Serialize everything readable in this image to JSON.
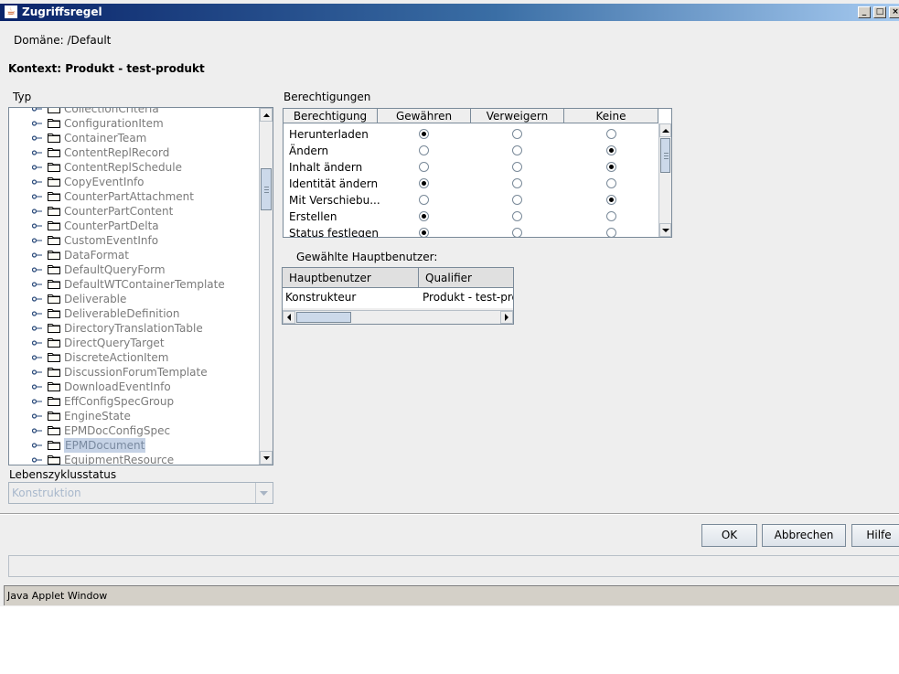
{
  "window": {
    "title": "Zugriffsregel",
    "icon": "java-coffee-icon",
    "controls": {
      "minimize": "_",
      "maximize": "□",
      "close": "×"
    }
  },
  "domain": {
    "label": "Domäne:",
    "value": "/Default"
  },
  "context": {
    "text": "Kontext: Produkt - test-produkt"
  },
  "type_panel": {
    "label": "Typ",
    "partial_top_item": "CollectionCriteria",
    "items": [
      "ConfigurationItem",
      "ContainerTeam",
      "ContentReplRecord",
      "ContentReplSchedule",
      "CopyEventInfo",
      "CounterPartAttachment",
      "CounterPartContent",
      "CounterPartDelta",
      "CustomEventInfo",
      "DataFormat",
      "DefaultQueryForm",
      "DefaultWTContainerTemplate",
      "Deliverable",
      "DeliverableDefinition",
      "DirectoryTranslationTable",
      "DirectQueryTarget",
      "DiscreteActionItem",
      "DiscussionForumTemplate",
      "DownloadEventInfo",
      "EffConfigSpecGroup",
      "EngineState",
      "EPMDocConfigSpec",
      "EPMDocument",
      "EquipmentResource"
    ],
    "selected": "EPMDocument"
  },
  "lifecycle": {
    "label": "Lebenszyklusstatus",
    "value": "Konstruktion"
  },
  "permissions": {
    "label": "Berechtigungen",
    "columns": [
      "Berechtigung",
      "Gewähren",
      "Verweigern",
      "Keine"
    ],
    "rows": [
      {
        "name": "Herunterladen",
        "selected": "Gewähren"
      },
      {
        "name": "Ändern",
        "selected": "Keine"
      },
      {
        "name": "Inhalt ändern",
        "selected": "Keine"
      },
      {
        "name": "Identität ändern",
        "selected": "Gewähren"
      },
      {
        "name": "Mit Verschiebu...",
        "selected": "Keine"
      },
      {
        "name": "Erstellen",
        "selected": "Gewähren"
      },
      {
        "name": "Status festlegen",
        "selected": "Gewähren"
      }
    ]
  },
  "principals": {
    "label": "Gewählte Hauptbenutzer:",
    "columns": [
      "Hauptbenutzer",
      "Qualifier"
    ],
    "rows": [
      {
        "principal": "Konstrukteur",
        "qualifier": "Produkt - test-prod"
      }
    ]
  },
  "buttons": {
    "ok": "OK",
    "cancel": "Abbrechen",
    "help": "Hilfe"
  },
  "status_bar": {
    "text": "Java Applet Window"
  }
}
